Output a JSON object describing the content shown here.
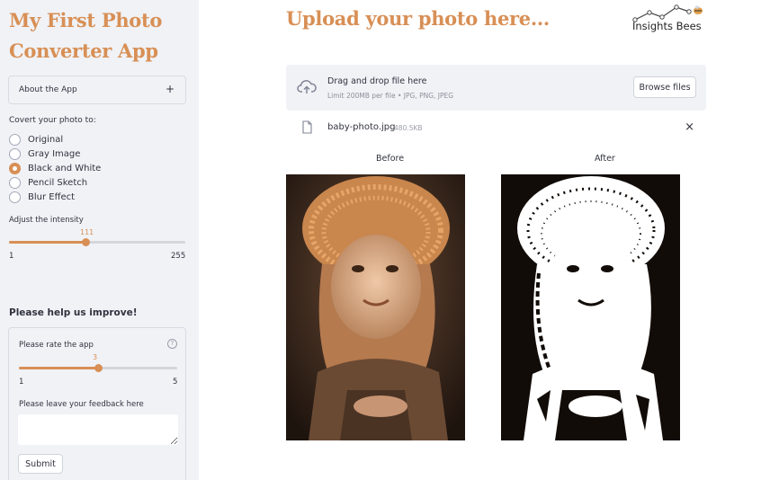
{
  "sidebar": {
    "app_title": "My First Photo Converter App",
    "about_label": "About the App",
    "about_toggle": "+",
    "radio_caption": "Covert your photo to:",
    "radio_options": [
      "Original",
      "Gray Image",
      "Black and White",
      "Pencil Sketch",
      "Blur Effect"
    ],
    "radio_selected": "Black and White",
    "intensity_caption": "Adjust the intensity",
    "intensity": {
      "value": "111",
      "min": "1",
      "max": "255",
      "fraction": 0.433
    },
    "help_title": "Please help us improve!",
    "rate_caption": "Please rate the app",
    "help_icon": "?",
    "rating": {
      "value": "3",
      "min": "1",
      "max": "5",
      "fraction": 0.5
    },
    "feedback_caption": "Please leave your feedback here",
    "feedback_value": "",
    "submit_label": "Submit"
  },
  "main": {
    "title": "Upload your photo here...",
    "logo_text": "Insights Bees",
    "uploader": {
      "title": "Drag and drop file here",
      "limit": "Limit 200MB per file • JPG, PNG, JPEG",
      "browse_label": "Browse files"
    },
    "file": {
      "name": "baby-photo.jpg",
      "size": "480.5KB",
      "close": "×"
    },
    "before_label": "Before",
    "after_label": "After"
  },
  "colors": {
    "accent": "#d88f55",
    "sidebar_bg": "#f0f2f6",
    "text": "#31333f"
  },
  "icons": {
    "upload": "cloud-upload-icon",
    "file": "file-icon",
    "close": "close-icon",
    "help": "help-circle-icon"
  }
}
